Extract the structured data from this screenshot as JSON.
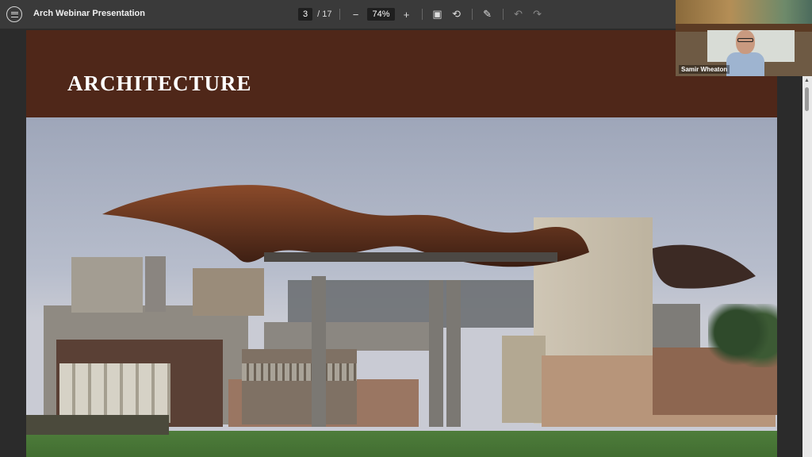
{
  "toolbar": {
    "title": "Arch Webinar Presentation",
    "page_current": "3",
    "page_total": "/ 17",
    "zoom": "74%",
    "icons": [
      "menu-icon",
      "zoom-out-icon",
      "zoom-in-icon",
      "fit-page-icon",
      "rotate-icon",
      "draw-icon",
      "undo-icon",
      "redo-icon"
    ],
    "zoom_out_glyph": "−",
    "zoom_in_glyph": "+",
    "fit_glyph": "▣",
    "rotate_glyph": "⟲",
    "draw_glyph": "✎",
    "undo_glyph": "↶",
    "redo_glyph": "↷"
  },
  "slide": {
    "title": "ARCHITECTURE",
    "header_color": "#4f2719",
    "image_description_icon": "building-photo"
  },
  "webcam": {
    "participant_name": "Samir Wheaton"
  },
  "colors": {
    "toolbar_bg": "#3a3a3a",
    "app_bg": "#2b2b2b",
    "slide_brown": "#4f2719"
  }
}
